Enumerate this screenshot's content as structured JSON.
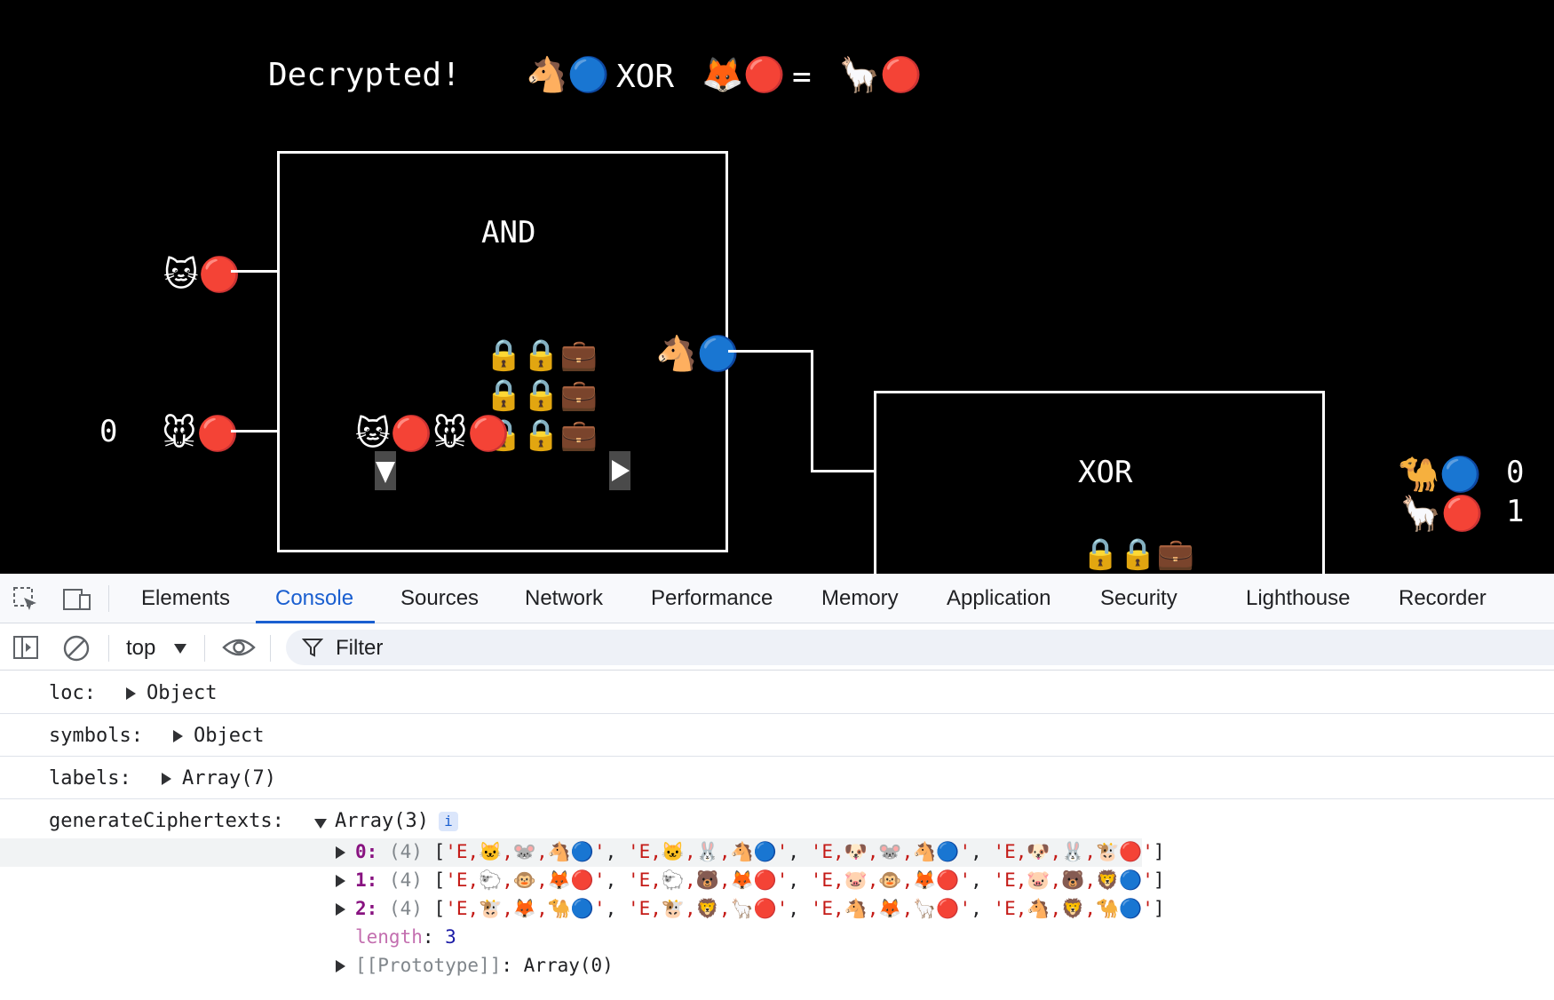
{
  "game": {
    "status_text": "Decrypted!",
    "equation": {
      "left": "🐴🔵",
      "operator": "XOR",
      "right": "🦊🔴",
      "equals": "=",
      "result": "🦙🔴"
    },
    "and_gate": {
      "label": "AND",
      "input_a": "🐱🔴",
      "input_b": "🐭🔴",
      "input_b_value": "0",
      "output": "🐴🔵",
      "ciphertext_rows": [
        "🔒🔒💼",
        "🔒🔒💼",
        "🔒🔒💼"
      ],
      "selected_inputs": "🐱🔴🐭🔴"
    },
    "xor_gate": {
      "label": "XOR",
      "ciphertext_row": "🔒🔒💼"
    },
    "output_legend": [
      {
        "symbol": "🐪🔵",
        "value": "0"
      },
      {
        "symbol": "🦙🔴",
        "value": "1"
      }
    ]
  },
  "devtools": {
    "tabs": [
      "Elements",
      "Console",
      "Sources",
      "Network",
      "Performance",
      "Memory",
      "Application",
      "Security",
      "Lighthouse",
      "Recorder"
    ],
    "active_tab": "Console",
    "toolbar": {
      "context": "top",
      "filter_placeholder": "Filter"
    },
    "console": {
      "entries": [
        {
          "key": "loc:",
          "value": "Object"
        },
        {
          "key": "symbols:",
          "value": "Object"
        },
        {
          "key": "labels:",
          "value": "Array(7)"
        },
        {
          "key": "generateCiphertexts:",
          "value": "Array(3)"
        }
      ],
      "info_badge": "i",
      "array_items": [
        {
          "index": "0:",
          "count": "(4)",
          "values": [
            "'E,🐱,🐭,🐴🔵'",
            "'E,🐱,🐰,🐴🔵'",
            "'E,🐶,🐭,🐴🔵'",
            "'E,🐶,🐰,🐮🔴'"
          ]
        },
        {
          "index": "1:",
          "count": "(4)",
          "values": [
            "'E,🐑,🐵,🦊🔴'",
            "'E,🐑,🐻,🦊🔴'",
            "'E,🐷,🐵,🦊🔴'",
            "'E,🐷,🐻,🦁🔵'"
          ]
        },
        {
          "index": "2:",
          "count": "(4)",
          "values": [
            "'E,🐮,🦊,🐪🔵'",
            "'E,🐮,🦁,🦙🔴'",
            "'E,🐴,🦊,🦙🔴'",
            "'E,🐴,🦁,🐪🔵'"
          ]
        }
      ],
      "length_key": "length",
      "length_value": "3",
      "prototype_key": "[[Prototype]]",
      "prototype_value": "Array(0)"
    }
  }
}
